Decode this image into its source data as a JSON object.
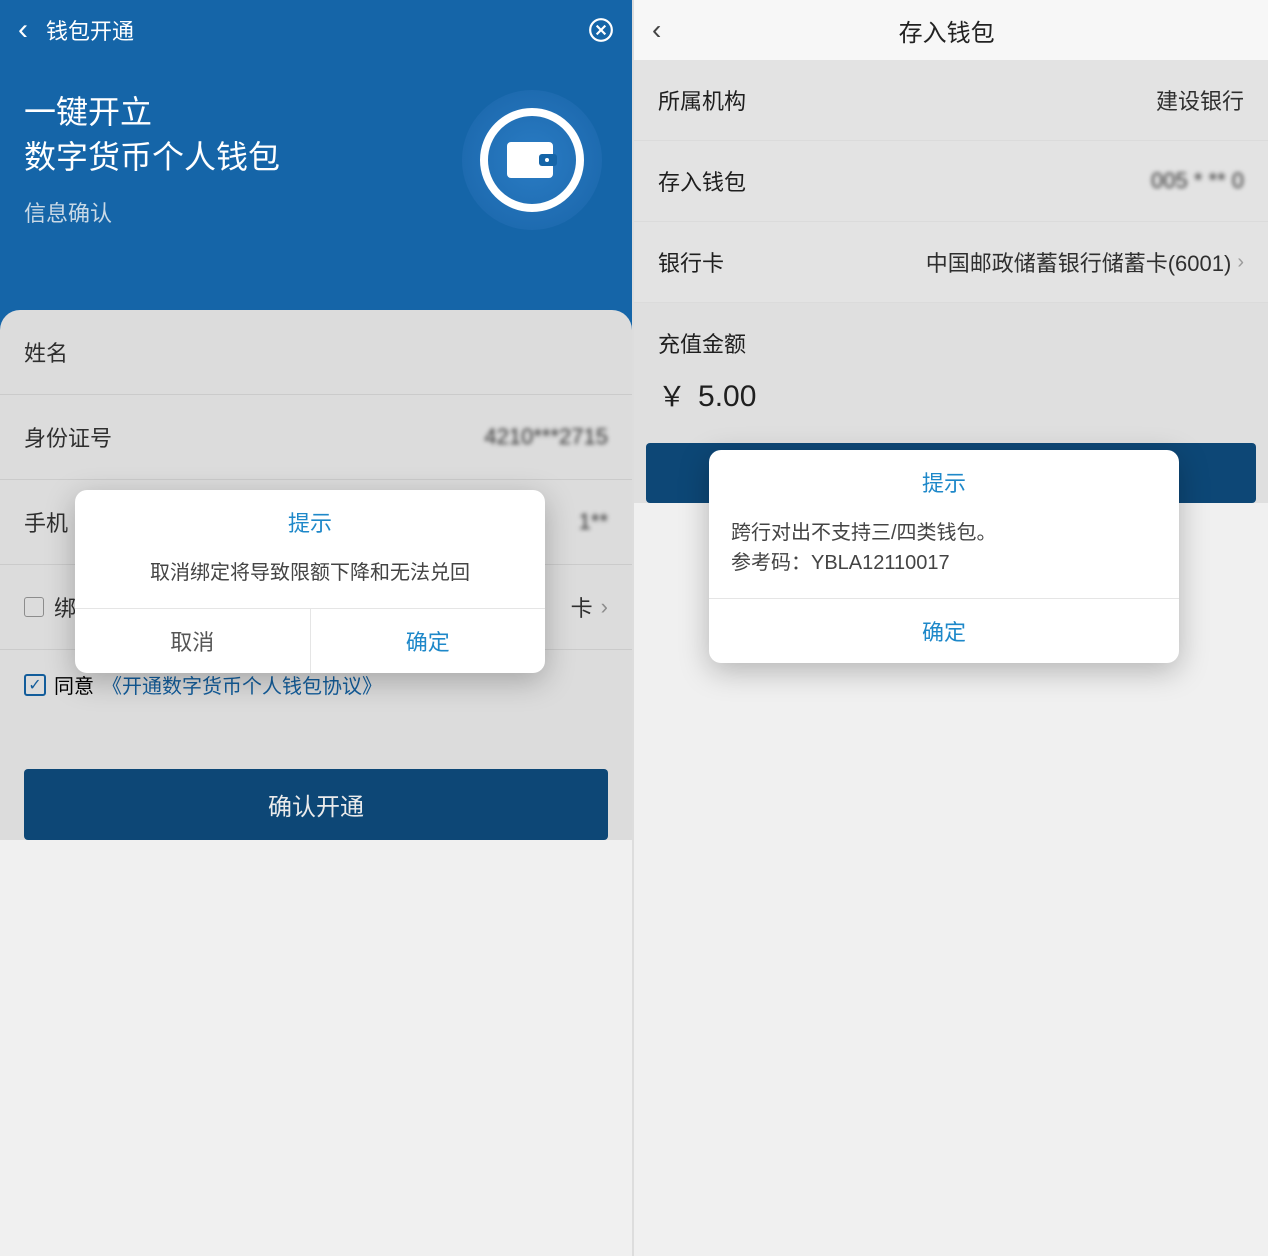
{
  "left": {
    "header": {
      "title": "钱包开通"
    },
    "hero": {
      "line1": "一键开立",
      "line2": "数字货币个人钱包",
      "sub": "信息确认"
    },
    "form": {
      "name_label": "姓名",
      "id_label": "身份证号",
      "id_value": "4210***2715",
      "phone_label": "手机",
      "phone_value": "1**",
      "bind_label": "绑",
      "bind_choice": "卡",
      "agree_label": "同意",
      "agreement_link": "《开通数字货币个人钱包协议》",
      "submit": "确认开通"
    },
    "modal": {
      "title": "提示",
      "body": "取消绑定将导致限额下降和无法兑回",
      "cancel": "取消",
      "ok": "确定"
    }
  },
  "right": {
    "header": {
      "title": "存入钱包"
    },
    "rows": {
      "org_label": "所属机构",
      "org_value": "建设银行",
      "wallet_label": "存入钱包",
      "wallet_value": "005 * ** 0",
      "card_label": "银行卡",
      "card_value": "中国邮政储蓄银行储蓄卡(6001)"
    },
    "amount": {
      "label": "充值金额",
      "currency": "￥",
      "value": "5.00"
    },
    "modal": {
      "title": "提示",
      "body1": "跨行对出不支持三/四类钱包。",
      "body2": "参考码：YBLA12110017",
      "ok": "确定"
    }
  }
}
